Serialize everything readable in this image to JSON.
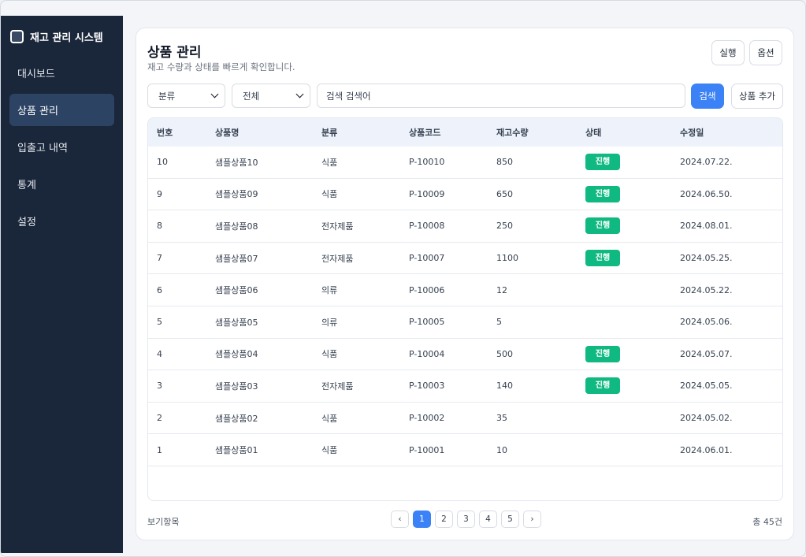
{
  "app": {
    "title": "재고 관리 시스템"
  },
  "nav": [
    {
      "label": "대시보드",
      "active": false
    },
    {
      "label": "상품 관리",
      "active": true
    },
    {
      "label": "입출고 내역",
      "active": false
    },
    {
      "label": "통계",
      "active": false
    },
    {
      "label": "설정",
      "active": false
    }
  ],
  "page": {
    "title": "상품 관리",
    "subtitle": "재고 수량과 상태를 빠르게 확인합니다.",
    "run_label": "실행",
    "options_label": "옵션"
  },
  "filters": {
    "category": "분류",
    "scope": "전체",
    "search_value": "검색 검색어",
    "search_button": "검색",
    "add_button": "상품 추가"
  },
  "table": {
    "headers": [
      "번호",
      "상품명",
      "분류",
      "상품코드",
      "재고수량",
      "상태",
      "수정일"
    ],
    "rows": [
      [
        "10",
        "샘플상품10",
        "식품",
        "P-10010",
        "850",
        "진행",
        "2024.07.22."
      ],
      [
        "9",
        "샘플상품09",
        "식품",
        "P-10009",
        "650",
        "진행",
        "2024.06.50."
      ],
      [
        "8",
        "샘플상품08",
        "전자제품",
        "P-10008",
        "250",
        "진행",
        "2024.08.01."
      ],
      [
        "7",
        "샘플상품07",
        "전자제품",
        "P-10007",
        "1100",
        "진행",
        "2024.05.25."
      ],
      [
        "6",
        "샘플상품06",
        "의류",
        "P-10006",
        "12",
        "",
        "2024.05.22."
      ],
      [
        "5",
        "샘플상품05",
        "의류",
        "P-10005",
        "5",
        "",
        "2024.05.06."
      ],
      [
        "4",
        "샘플상품04",
        "식품",
        "P-10004",
        "500",
        "진행",
        "2024.05.07."
      ],
      [
        "3",
        "샘플상품03",
        "전자제품",
        "P-10003",
        "140",
        "진행",
        "2024.05.05."
      ],
      [
        "2",
        "샘플상품02",
        "식품",
        "P-10002",
        "35",
        "",
        "2024.05.02."
      ],
      [
        "1",
        "샘플상품01",
        "식품",
        "P-10001",
        "10",
        "",
        "2024.06.01."
      ]
    ]
  },
  "footer": {
    "view_label": "보기항목",
    "total": "총 45건",
    "prev": "‹",
    "next": "›",
    "pages": [
      "1",
      "2",
      "3",
      "4",
      "5"
    ],
    "current_page": "1"
  },
  "colors": {
    "accent": "#3b82f6",
    "status_green": "#10b981",
    "sidebar": "#1a2639"
  }
}
